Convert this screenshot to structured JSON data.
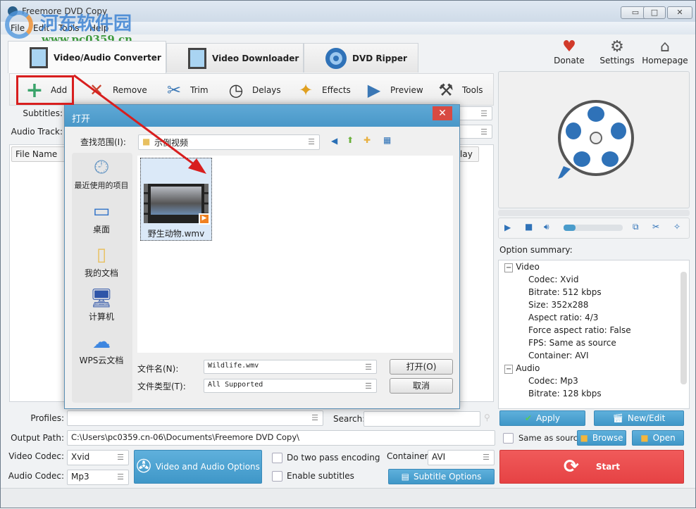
{
  "window": {
    "title": "Freemore DVD Copy",
    "controls": [
      "minimize",
      "maximize",
      "close"
    ]
  },
  "watermark": {
    "name": "河东软件园",
    "url": "www.pc0359.cn"
  },
  "menu": [
    "File",
    "Edit",
    "Tools",
    "Help"
  ],
  "tabs": [
    {
      "label": "Video/Audio Converter",
      "active": true
    },
    {
      "label": "Video Downloader"
    },
    {
      "label": "DVD Ripper"
    }
  ],
  "top_actions": [
    {
      "label": "Donate",
      "icon": "heart-icon"
    },
    {
      "label": "Settings",
      "icon": "gear-icon"
    },
    {
      "label": "Homepage",
      "icon": "home-icon"
    }
  ],
  "toolbar": [
    {
      "label": "Add",
      "icon": "plus-icon"
    },
    {
      "label": "Remove",
      "icon": "x-icon"
    },
    {
      "label": "Trim",
      "icon": "scissors-icon"
    },
    {
      "label": "Delays",
      "icon": "clock-icon"
    },
    {
      "label": "Effects",
      "icon": "magic-wand-icon"
    },
    {
      "label": "Preview",
      "icon": "film-play-icon"
    },
    {
      "label": "Tools",
      "icon": "tools-icon"
    }
  ],
  "fields": {
    "subtitles_label": "Subtitles:",
    "audio_track_label": "Audio Track:"
  },
  "file_list": {
    "columns": [
      "File Name",
      "lay"
    ]
  },
  "player": {
    "volume_percent": 20
  },
  "summary": {
    "label": "Option summary:",
    "groups": [
      {
        "name": "Video",
        "items": [
          "Codec: Xvid",
          "Bitrate: 512 kbps",
          "Size: 352x288",
          "Aspect ratio: 4/3",
          "Force aspect ratio: False",
          "FPS: Same as source",
          "Container: AVI"
        ]
      },
      {
        "name": "Audio",
        "items": [
          "Codec: Mp3",
          "Bitrate: 128 kbps"
        ]
      }
    ]
  },
  "bottom": {
    "profiles_label": "Profiles:",
    "profiles_value": "",
    "search_label": "Search:",
    "search_value": "",
    "apply": "Apply",
    "new_edit": "New/Edit",
    "output_label": "Output Path:",
    "output_value": "C:\\Users\\pc0359.cn-06\\Documents\\Freemore DVD Copy\\",
    "same_as_source": "Same as source",
    "browse": "Browse",
    "open": "Open",
    "video_codec_label": "Video Codec:",
    "video_codec": "Xvid",
    "audio_codec_label": "Audio Codec:",
    "audio_codec": "Mp3",
    "av_options": "Video and Audio Options",
    "two_pass": "Do two pass encoding",
    "enable_subs": "Enable subtitles",
    "container_label": "Container:",
    "container": "AVI",
    "subtitle_options": "Subtitle Options",
    "start": "Start"
  },
  "dialog": {
    "title": "打开",
    "look_in_label": "查找范围(I):",
    "look_in_value": "示例视频",
    "places": [
      "最近使用的项目",
      "桌面",
      "我的文档",
      "计算机",
      "WPS云文档"
    ],
    "files": [
      {
        "name": "野生动物.wmv"
      }
    ],
    "filename_label": "文件名(N):",
    "filename_value": "Wildlife.wmv",
    "filetype_label": "文件类型(T):",
    "filetype_value": "All Supported",
    "open_btn": "打开(O)",
    "cancel_btn": "取消"
  },
  "colors": {
    "accent": "#4a9ccb",
    "start": "#e8484a",
    "annotation": "#d81e1e"
  }
}
